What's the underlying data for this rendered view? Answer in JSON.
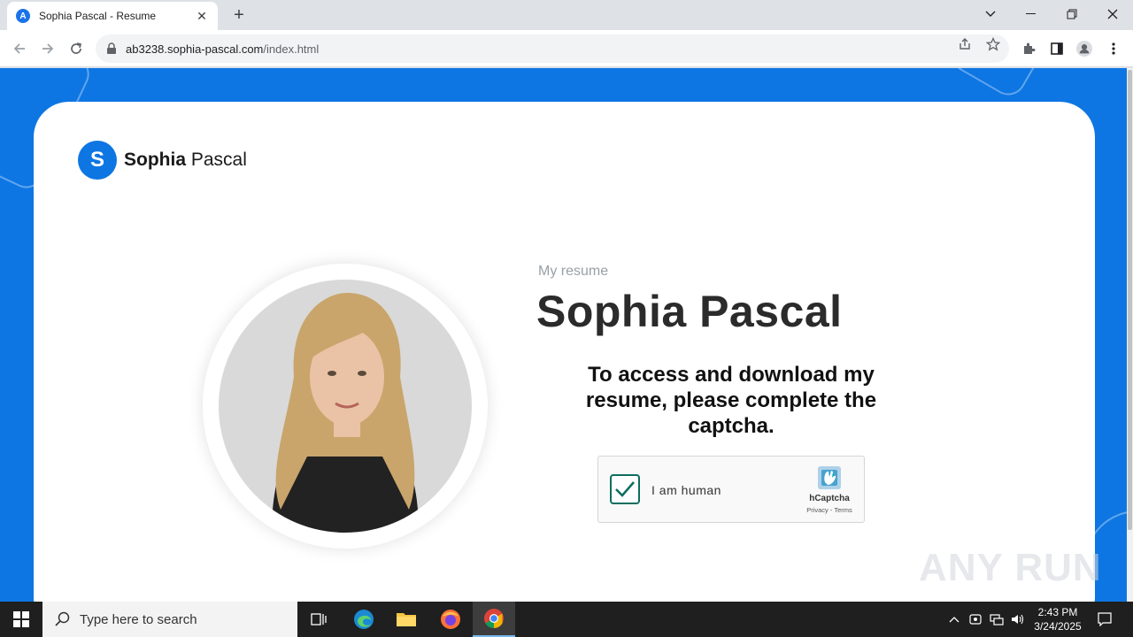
{
  "browser": {
    "tab_title": "Sophia Pascal - Resume",
    "tab_favicon_letter": "A",
    "url_domain": "ab3238.sophia-pascal.com",
    "url_path": "/index.html"
  },
  "page": {
    "logo": {
      "mark_letter": "S",
      "first_name": "Sophia",
      "last_name": " Pascal"
    },
    "eyebrow": "My resume",
    "name": "Sophia Pascal",
    "message": "To access and download my resume, please complete the captcha.",
    "captcha": {
      "label": "I am human",
      "checked": true,
      "brand": "hCaptcha",
      "links": "Privacy - Terms"
    },
    "accent_color": "#0d76e3",
    "watermark": "ANY RUN"
  },
  "taskbar": {
    "search_placeholder": "Type here to search",
    "time": "2:43 PM",
    "date": "3/24/2025",
    "apps": [
      "task-view",
      "edge",
      "file-explorer",
      "firefox",
      "chrome"
    ]
  }
}
